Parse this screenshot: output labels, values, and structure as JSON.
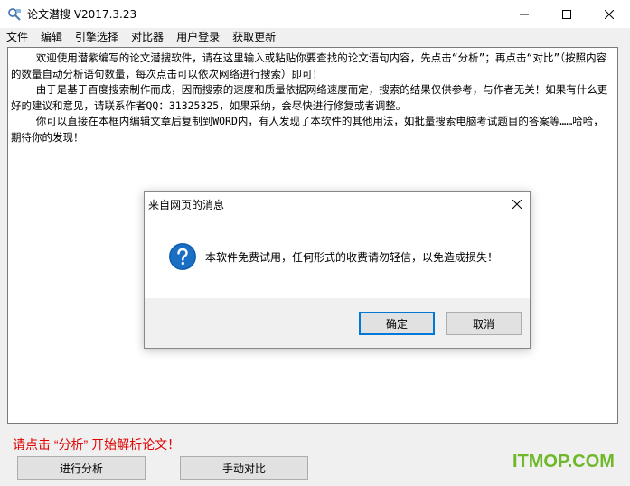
{
  "window": {
    "title": "论文潜搜 V2017.3.23"
  },
  "menu": [
    "文件",
    "编辑",
    "引擎选择",
    "对比器",
    "用户登录",
    "获取更新"
  ],
  "editor": {
    "paragraphs": [
      "    欢迎使用潜紫编写的论文潜搜软件，请在这里输入或粘贴你要查找的论文语句内容，先点击“分析”；再点击“对比”（按照内容的数量自动分析语句数量，每次点击可以依次网络进行搜索）即可！",
      "    由于是基于百度搜索制作而成，因而搜索的速度和质量依据网络速度而定，搜索的结果仅供参考，与作者无关！如果有什么更好的建议和意见，请联系作者QQ：31325325，如果采纳，会尽快进行修复或者调整。",
      "    你可以直接在本框内编辑文章后复制到WORD内，有人发现了本软件的其他用法，如批量搜索电脑考试题目的答案等……哈哈，期待你的发现！"
    ]
  },
  "status": {
    "hint": "请点击 “分析” 开始解析论文！"
  },
  "buttons": {
    "analyze": "进行分析",
    "compare": "手动对比"
  },
  "watermark": "ITMOP.COM",
  "dialog": {
    "title": "来自网页的消息",
    "message": "本软件免费试用，任何形式的收费请勿轻信，以免造成损失！",
    "ok": "确定",
    "cancel": "取消",
    "icon": "question-icon"
  },
  "colors": {
    "status_red": "#e00000",
    "accent_blue": "#0078d7",
    "watermark_green": "#6fb82a"
  }
}
